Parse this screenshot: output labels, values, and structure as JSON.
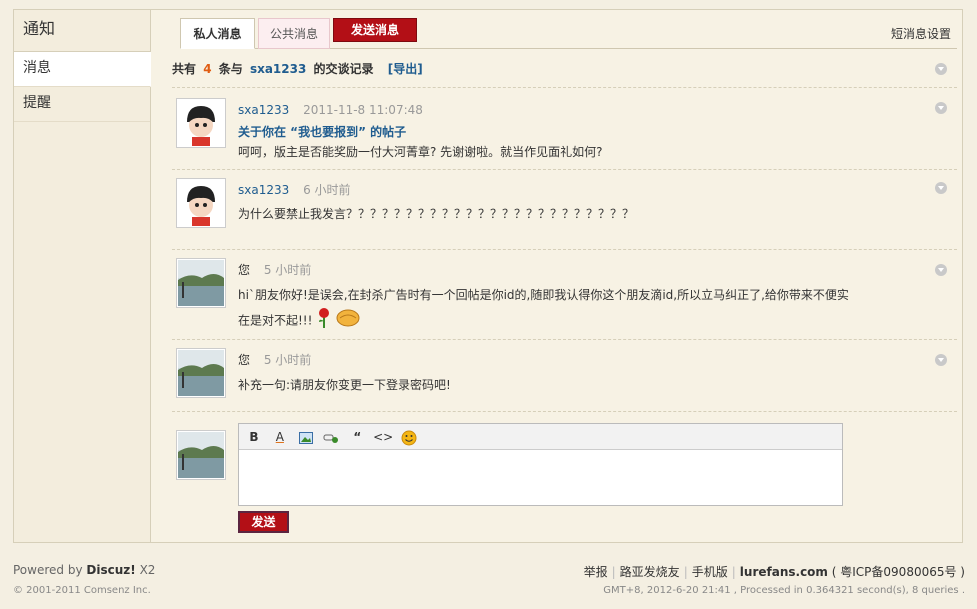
{
  "sidebar": {
    "title": "通知",
    "items": [
      {
        "label": "消息"
      },
      {
        "label": "提醒"
      }
    ]
  },
  "tabs": {
    "private": "私人消息",
    "public": "公共消息",
    "send": "发送消息",
    "settings": "短消息设置"
  },
  "summary": {
    "prefix": "共有",
    "count": "4",
    "middle": "条与",
    "user": "sxa1233",
    "suffix": "的交谈记录",
    "export": "[导出]"
  },
  "messages": [
    {
      "user": "sxa1233",
      "time": "2011-11-8 11:07:48",
      "subject": "关于你在 “我也要报到” 的帖子",
      "text": "呵呵，版主是否能奖励一付大河菁章? 先谢谢啦。就当作见面礼如何?"
    },
    {
      "user": "sxa1233",
      "time": "6 小时前",
      "text": "为什么要禁止我发言？？？？？？？？？？？？？？？？？？？？？？？？"
    },
    {
      "user": "您",
      "time": "5 小时前",
      "text": "hi`朋友你好!是误会,在封杀广告时有一个回帖是你id的,随即我认得你这个朋友滴id,所以立马纠正了,给你带来不便实",
      "text2": "在是对不起!!!"
    },
    {
      "user": "您",
      "time": "5 小时前",
      "text": "补充一句:请朋友你变更一下登录密码吧!"
    }
  ],
  "editor": {
    "toolbar": [
      "B",
      "A",
      "image",
      "link",
      "quote",
      "code",
      "smiley"
    ],
    "send": "发送"
  },
  "footer": {
    "powered": "Powered by",
    "brand": "Discuz!",
    "version": "X2",
    "copyright": "© 2001-2011 Comsenz Inc.",
    "links": [
      "举报",
      "路亚发烧友",
      "手机版"
    ],
    "site": "lurefans.com",
    "icp": "( 粤ICP备09080065号 )",
    "info": "GMT+8, 2012-6-20 21:41 , Processed in 0.364321 second(s), 8 queries ."
  }
}
